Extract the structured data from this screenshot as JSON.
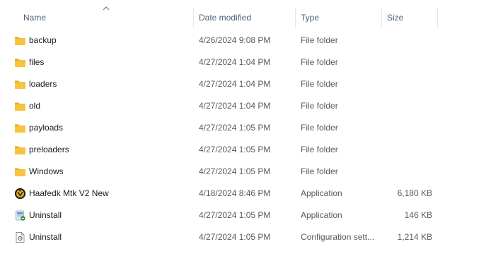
{
  "columns": {
    "name": "Name",
    "date_modified": "Date modified",
    "type": "Type",
    "size": "Size"
  },
  "sort": {
    "column": "name",
    "direction": "ascending",
    "icon": "sort-up-chevron-icon"
  },
  "colors": {
    "folder": "#f8c440",
    "folder_dark": "#e0a91f",
    "header_text": "#4c607a",
    "secondary_text": "#5a5a5a"
  },
  "files": [
    {
      "name": "backup",
      "date": "4/26/2024 9:08 PM",
      "type": "File folder",
      "size": "",
      "icon": "folder-icon"
    },
    {
      "name": "files",
      "date": "4/27/2024 1:04 PM",
      "type": "File folder",
      "size": "",
      "icon": "folder-icon"
    },
    {
      "name": "loaders",
      "date": "4/27/2024 1:04 PM",
      "type": "File folder",
      "size": "",
      "icon": "folder-icon"
    },
    {
      "name": "old",
      "date": "4/27/2024 1:04 PM",
      "type": "File folder",
      "size": "",
      "icon": "folder-icon"
    },
    {
      "name": "payloads",
      "date": "4/27/2024 1:05 PM",
      "type": "File folder",
      "size": "",
      "icon": "folder-icon"
    },
    {
      "name": "preloaders",
      "date": "4/27/2024 1:05 PM",
      "type": "File folder",
      "size": "",
      "icon": "folder-icon"
    },
    {
      "name": "Windows",
      "date": "4/27/2024 1:05 PM",
      "type": "File folder",
      "size": "",
      "icon": "folder-icon"
    },
    {
      "name": "Haafedk Mtk V2 New",
      "date": "4/18/2024 8:46 PM",
      "type": "Application",
      "size": "6,180 KB",
      "icon": "app-logo-icon"
    },
    {
      "name": "Uninstall",
      "date": "4/27/2024 1:05 PM",
      "type": "Application",
      "size": "146 KB",
      "icon": "uninstaller-icon"
    },
    {
      "name": "Uninstall",
      "date": "4/27/2024 1:05 PM",
      "type": "Configuration sett...",
      "size": "1,214 KB",
      "icon": "config-file-icon"
    }
  ]
}
